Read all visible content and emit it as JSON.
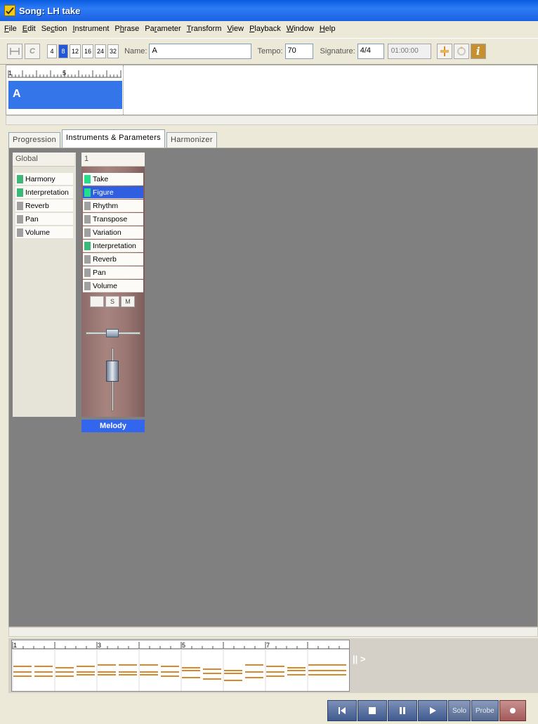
{
  "window": {
    "title": "Song: LH take"
  },
  "menu": [
    {
      "pre": "",
      "u": "F",
      "post": "ile"
    },
    {
      "pre": "",
      "u": "E",
      "post": "dit"
    },
    {
      "pre": "Se",
      "u": "c",
      "post": "tion"
    },
    {
      "pre": "",
      "u": "I",
      "post": "nstrument"
    },
    {
      "pre": "P",
      "u": "h",
      "post": "rase"
    },
    {
      "pre": "Pa",
      "u": "r",
      "post": "ameter"
    },
    {
      "pre": "",
      "u": "T",
      "post": "ransform"
    },
    {
      "pre": "",
      "u": "V",
      "post": "iew"
    },
    {
      "pre": "",
      "u": "P",
      "post": "layback"
    },
    {
      "pre": "",
      "u": "W",
      "post": "indow"
    },
    {
      "pre": "",
      "u": "H",
      "post": "elp"
    }
  ],
  "toolbar": {
    "c_label": "C",
    "grid_buttons": [
      "4",
      "8",
      "12",
      "16",
      "24",
      "32"
    ],
    "grid_selected": "8",
    "name_label": "Name:",
    "name_value": "A",
    "tempo_label": "Tempo:",
    "tempo_value": "70",
    "signature_label": "Signature:",
    "signature_value": "4/4",
    "time_value": "01:00:00",
    "info_label": "i"
  },
  "section": {
    "ruler_labels": [
      "1",
      "5"
    ],
    "block_label": "A"
  },
  "tabs": [
    {
      "label": "Progression",
      "active": false
    },
    {
      "label": "Instruments & Parameters",
      "active": true
    },
    {
      "label": "Harmonizer",
      "active": false
    }
  ],
  "global_strip": {
    "header": "Global",
    "params": [
      {
        "label": "Harmony",
        "color": "#3cb878"
      },
      {
        "label": "Interpretation",
        "color": "#3cb878"
      },
      {
        "label": "Reverb",
        "color": "#a0a0a0"
      },
      {
        "label": "Pan",
        "color": "#a0a0a0"
      },
      {
        "label": "Volume",
        "color": "#a0a0a0"
      }
    ]
  },
  "channel_strip": {
    "header": "1",
    "params": [
      {
        "label": "Take",
        "color": "#22e08a",
        "selected": false
      },
      {
        "label": "Figure",
        "color": "#22e08a",
        "selected": true
      },
      {
        "label": "Rhythm",
        "color": "#a0a0a0",
        "selected": false
      },
      {
        "label": "Transpose",
        "color": "#a0a0a0",
        "selected": false
      },
      {
        "label": "Variation",
        "color": "#a0a0a0",
        "selected": false
      },
      {
        "label": "Interpretation",
        "color": "#3cb878",
        "selected": false
      },
      {
        "label": "Reverb",
        "color": "#a0a0a0",
        "selected": false
      },
      {
        "label": "Pan",
        "color": "#a0a0a0",
        "selected": false
      },
      {
        "label": "Volume",
        "color": "#a0a0a0",
        "selected": false
      }
    ],
    "solo_label": "S",
    "mute_label": "M",
    "name": "Melody"
  },
  "piano_roll": {
    "ruler_labels": [
      "1",
      "3",
      "5",
      "7"
    ],
    "play_label": "|| >",
    "note_color": "#d9892a"
  },
  "transport": {
    "solo_label": "Solo",
    "probe_label": "Probe"
  },
  "colors": {
    "accent": "#3366ee",
    "selection": "#2f5fe0",
    "workspace": "#808080"
  }
}
